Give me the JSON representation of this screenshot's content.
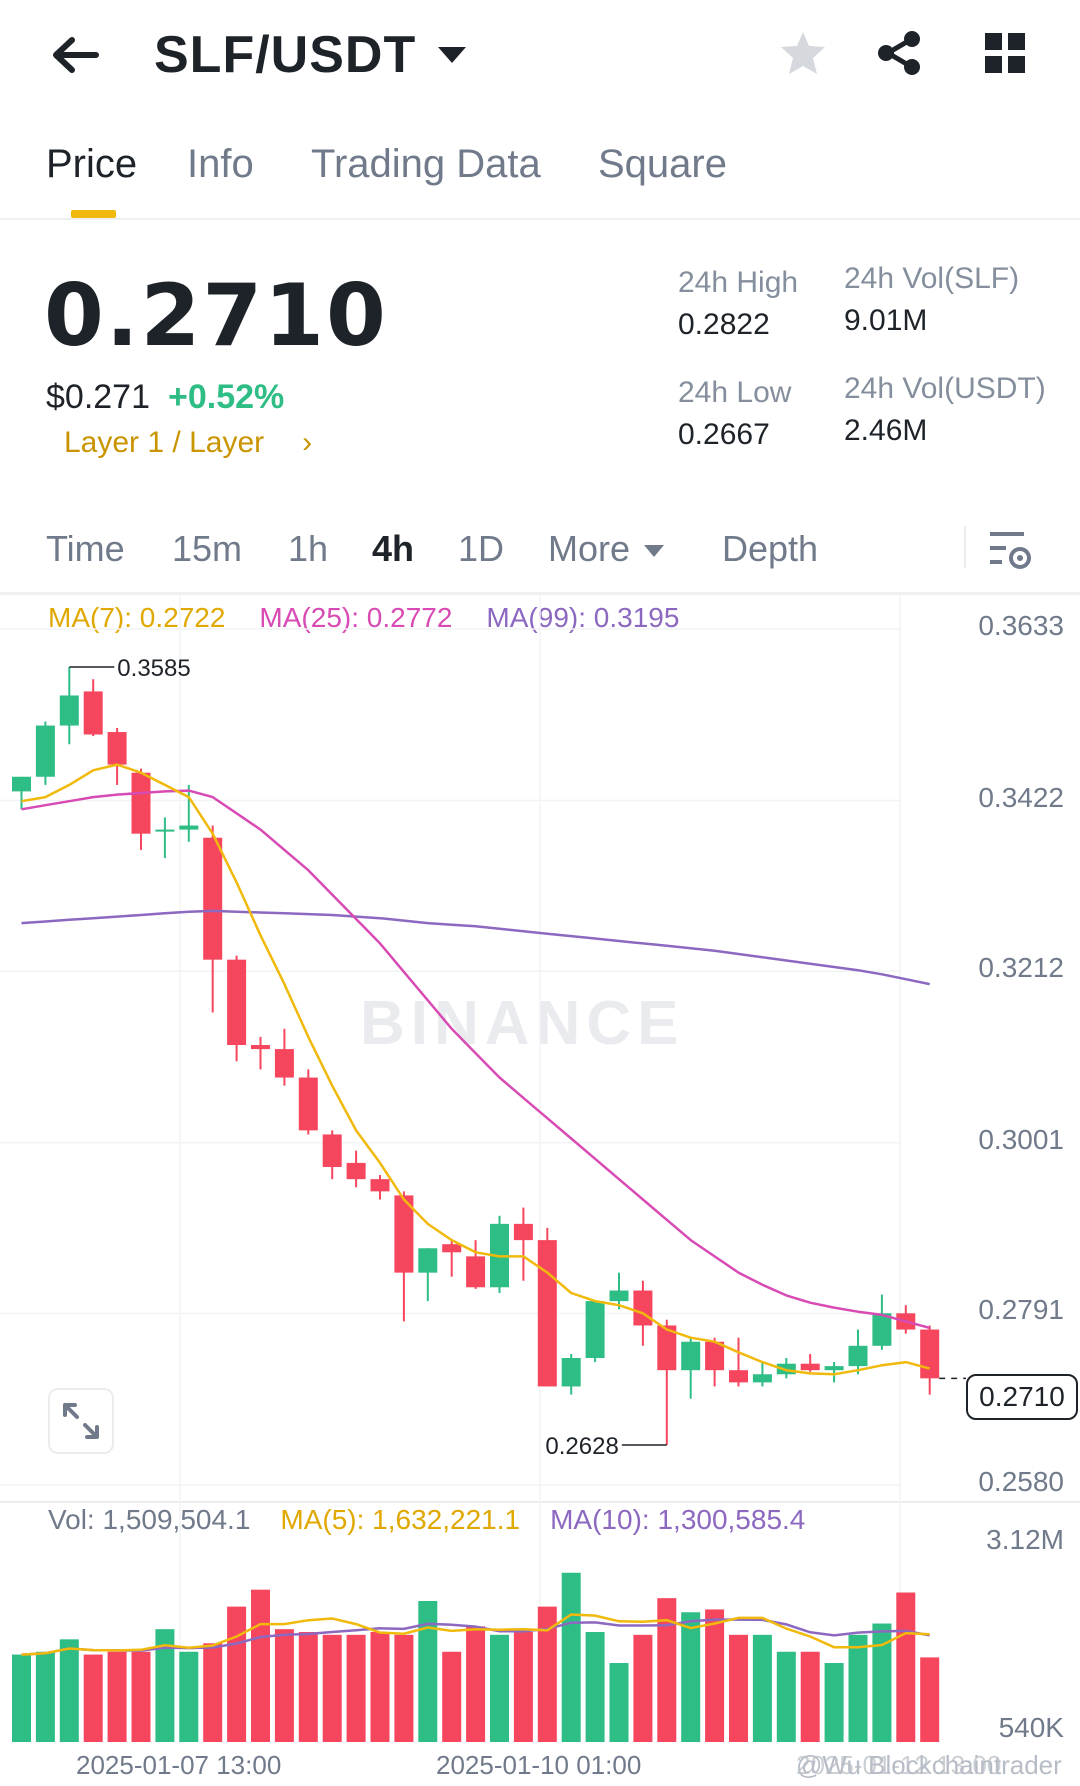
{
  "header": {
    "title": "SLF/USDT"
  },
  "tabs": [
    {
      "label": "Price",
      "active": true
    },
    {
      "label": "Info"
    },
    {
      "label": "Trading Data"
    },
    {
      "label": "Square"
    }
  ],
  "price": {
    "last": "0.2710",
    "usd": "$0.271",
    "change": "+0.52%",
    "tag": "Layer 1 / Layer",
    "stats": {
      "high_label": "24h High",
      "high_value": "0.2822",
      "low_label": "24h Low",
      "low_value": "0.2667",
      "vol_base_label": "24h Vol(SLF)",
      "vol_base_value": "9.01M",
      "vol_quote_label": "24h Vol(USDT)",
      "vol_quote_value": "2.46M"
    }
  },
  "timeframes": {
    "items": [
      {
        "label": "Time"
      },
      {
        "label": "15m"
      },
      {
        "label": "1h"
      },
      {
        "label": "4h",
        "active": true
      },
      {
        "label": "1D"
      },
      {
        "label": "More"
      },
      {
        "label": "Depth"
      }
    ]
  },
  "indicators": {
    "ma7": "MA(7): 0.2722",
    "ma25": "MA(25): 0.2772",
    "ma99": "MA(99): 0.3195",
    "vol": "Vol: 1,509,504.1",
    "vol_ma5": "MA(5): 1,632,221.1",
    "vol_ma10": "MA(10): 1,300,585.4"
  },
  "colors": {
    "up": "#2ebd85",
    "down": "#f6465d",
    "ma7": "#f0b90b",
    "ma25": "#d84ab4",
    "ma99": "#8c68c0",
    "accent": "#f0b90b"
  },
  "watermark": "BINANCE",
  "corner_watermark": "@Wu Blockchaintrader",
  "chart_data": {
    "type": "candlestick",
    "interval": "4h",
    "price_axis": {
      "ticks": [
        "0.3633",
        "0.3422",
        "0.3212",
        "0.3001",
        "0.2791",
        "0.2580"
      ],
      "ylim": [
        0.258,
        0.3633
      ]
    },
    "volume_axis": {
      "ticks": [
        "3.12M",
        "540K"
      ]
    },
    "x_ticks": [
      "2025-01-07 13:00",
      "2025-01-10 01:00",
      "2025-01-12 13:00"
    ],
    "annotations": {
      "high_label": "0.3585",
      "low_label": "0.2628",
      "last_price": "0.2710"
    },
    "candles": [
      {
        "o": 0.3432,
        "h": 0.345,
        "l": 0.341,
        "c": 0.345
      },
      {
        "o": 0.345,
        "h": 0.3518,
        "l": 0.344,
        "c": 0.3513
      },
      {
        "o": 0.3513,
        "h": 0.3585,
        "l": 0.349,
        "c": 0.355
      },
      {
        "o": 0.3555,
        "h": 0.357,
        "l": 0.35,
        "c": 0.3502
      },
      {
        "o": 0.3505,
        "h": 0.351,
        "l": 0.344,
        "c": 0.3465
      },
      {
        "o": 0.3455,
        "h": 0.346,
        "l": 0.336,
        "c": 0.338
      },
      {
        "o": 0.3385,
        "h": 0.34,
        "l": 0.335,
        "c": 0.3385
      },
      {
        "o": 0.3385,
        "h": 0.344,
        "l": 0.337,
        "c": 0.339
      },
      {
        "o": 0.3375,
        "h": 0.339,
        "l": 0.316,
        "c": 0.3225
      },
      {
        "o": 0.3225,
        "h": 0.323,
        "l": 0.31,
        "c": 0.312
      },
      {
        "o": 0.312,
        "h": 0.313,
        "l": 0.309,
        "c": 0.3115
      },
      {
        "o": 0.3115,
        "h": 0.314,
        "l": 0.307,
        "c": 0.308
      },
      {
        "o": 0.308,
        "h": 0.309,
        "l": 0.301,
        "c": 0.3015
      },
      {
        "o": 0.301,
        "h": 0.3015,
        "l": 0.2955,
        "c": 0.297
      },
      {
        "o": 0.2975,
        "h": 0.299,
        "l": 0.2945,
        "c": 0.2955
      },
      {
        "o": 0.2955,
        "h": 0.296,
        "l": 0.293,
        "c": 0.294
      },
      {
        "o": 0.2935,
        "h": 0.294,
        "l": 0.278,
        "c": 0.284
      },
      {
        "o": 0.284,
        "h": 0.287,
        "l": 0.2805,
        "c": 0.287
      },
      {
        "o": 0.2875,
        "h": 0.288,
        "l": 0.2835,
        "c": 0.2865
      },
      {
        "o": 0.286,
        "h": 0.288,
        "l": 0.282,
        "c": 0.2822
      },
      {
        "o": 0.2822,
        "h": 0.291,
        "l": 0.2815,
        "c": 0.29
      },
      {
        "o": 0.29,
        "h": 0.292,
        "l": 0.283,
        "c": 0.288
      },
      {
        "o": 0.288,
        "h": 0.2895,
        "l": 0.27,
        "c": 0.27
      },
      {
        "o": 0.27,
        "h": 0.274,
        "l": 0.269,
        "c": 0.2735
      },
      {
        "o": 0.2735,
        "h": 0.2805,
        "l": 0.273,
        "c": 0.2805
      },
      {
        "o": 0.2805,
        "h": 0.284,
        "l": 0.2795,
        "c": 0.2818
      },
      {
        "o": 0.2818,
        "h": 0.283,
        "l": 0.275,
        "c": 0.2775
      },
      {
        "o": 0.2775,
        "h": 0.2782,
        "l": 0.2628,
        "c": 0.272
      },
      {
        "o": 0.272,
        "h": 0.276,
        "l": 0.2685,
        "c": 0.2755
      },
      {
        "o": 0.2755,
        "h": 0.276,
        "l": 0.27,
        "c": 0.272
      },
      {
        "o": 0.272,
        "h": 0.276,
        "l": 0.27,
        "c": 0.2705
      },
      {
        "o": 0.2705,
        "h": 0.273,
        "l": 0.27,
        "c": 0.2715
      },
      {
        "o": 0.2715,
        "h": 0.2735,
        "l": 0.271,
        "c": 0.2728
      },
      {
        "o": 0.2728,
        "h": 0.274,
        "l": 0.2718,
        "c": 0.272
      },
      {
        "o": 0.272,
        "h": 0.273,
        "l": 0.2705,
        "c": 0.2725
      },
      {
        "o": 0.2725,
        "h": 0.277,
        "l": 0.2715,
        "c": 0.275
      },
      {
        "o": 0.275,
        "h": 0.2813,
        "l": 0.2745,
        "c": 0.279
      },
      {
        "o": 0.279,
        "h": 0.28,
        "l": 0.2765,
        "c": 0.277
      },
      {
        "o": 0.277,
        "h": 0.2775,
        "l": 0.269,
        "c": 0.271
      }
    ],
    "ma7": [
      0.342,
      0.3425,
      0.344,
      0.3458,
      0.3465,
      0.3455,
      0.344,
      0.3425,
      0.338,
      0.332,
      0.3255,
      0.3195,
      0.313,
      0.307,
      0.3015,
      0.2975,
      0.293,
      0.29,
      0.288,
      0.2865,
      0.286,
      0.286,
      0.284,
      0.2815,
      0.2805,
      0.28,
      0.279,
      0.277,
      0.276,
      0.2755,
      0.2742,
      0.273,
      0.272,
      0.2716,
      0.2715,
      0.272,
      0.2726,
      0.273,
      0.2722
    ],
    "ma25": [
      0.341,
      0.3415,
      0.342,
      0.3425,
      0.3428,
      0.343,
      0.3432,
      0.3433,
      0.3425,
      0.3405,
      0.3385,
      0.336,
      0.3335,
      0.3305,
      0.3275,
      0.3245,
      0.321,
      0.3175,
      0.314,
      0.311,
      0.308,
      0.3055,
      0.303,
      0.3005,
      0.298,
      0.2955,
      0.293,
      0.2905,
      0.288,
      0.286,
      0.284,
      0.2825,
      0.2812,
      0.2803,
      0.2797,
      0.2792,
      0.2788,
      0.278,
      0.2772
    ],
    "ma99": [
      0.327,
      0.3272,
      0.3274,
      0.3276,
      0.3278,
      0.328,
      0.3282,
      0.3284,
      0.3285,
      0.3284,
      0.3283,
      0.3282,
      0.3281,
      0.328,
      0.3278,
      0.3276,
      0.3273,
      0.327,
      0.3268,
      0.3266,
      0.3263,
      0.326,
      0.3257,
      0.3254,
      0.3251,
      0.3248,
      0.3245,
      0.3242,
      0.3239,
      0.3236,
      0.3232,
      0.3228,
      0.3224,
      0.322,
      0.3216,
      0.3212,
      0.3207,
      0.3201,
      0.3195
    ],
    "volume": [
      1.55,
      1.6,
      1.82,
      1.55,
      1.6,
      1.6,
      2.0,
      1.6,
      1.75,
      2.4,
      2.7,
      2.0,
      1.95,
      1.9,
      1.9,
      1.95,
      1.9,
      2.5,
      1.6,
      2.05,
      1.9,
      1.95,
      2.4,
      3.0,
      1.95,
      1.4,
      1.9,
      2.55,
      2.3,
      2.35,
      1.9,
      1.9,
      1.6,
      1.6,
      1.4,
      1.9,
      2.1,
      2.65,
      1.5
    ],
    "volume_units": "M"
  }
}
